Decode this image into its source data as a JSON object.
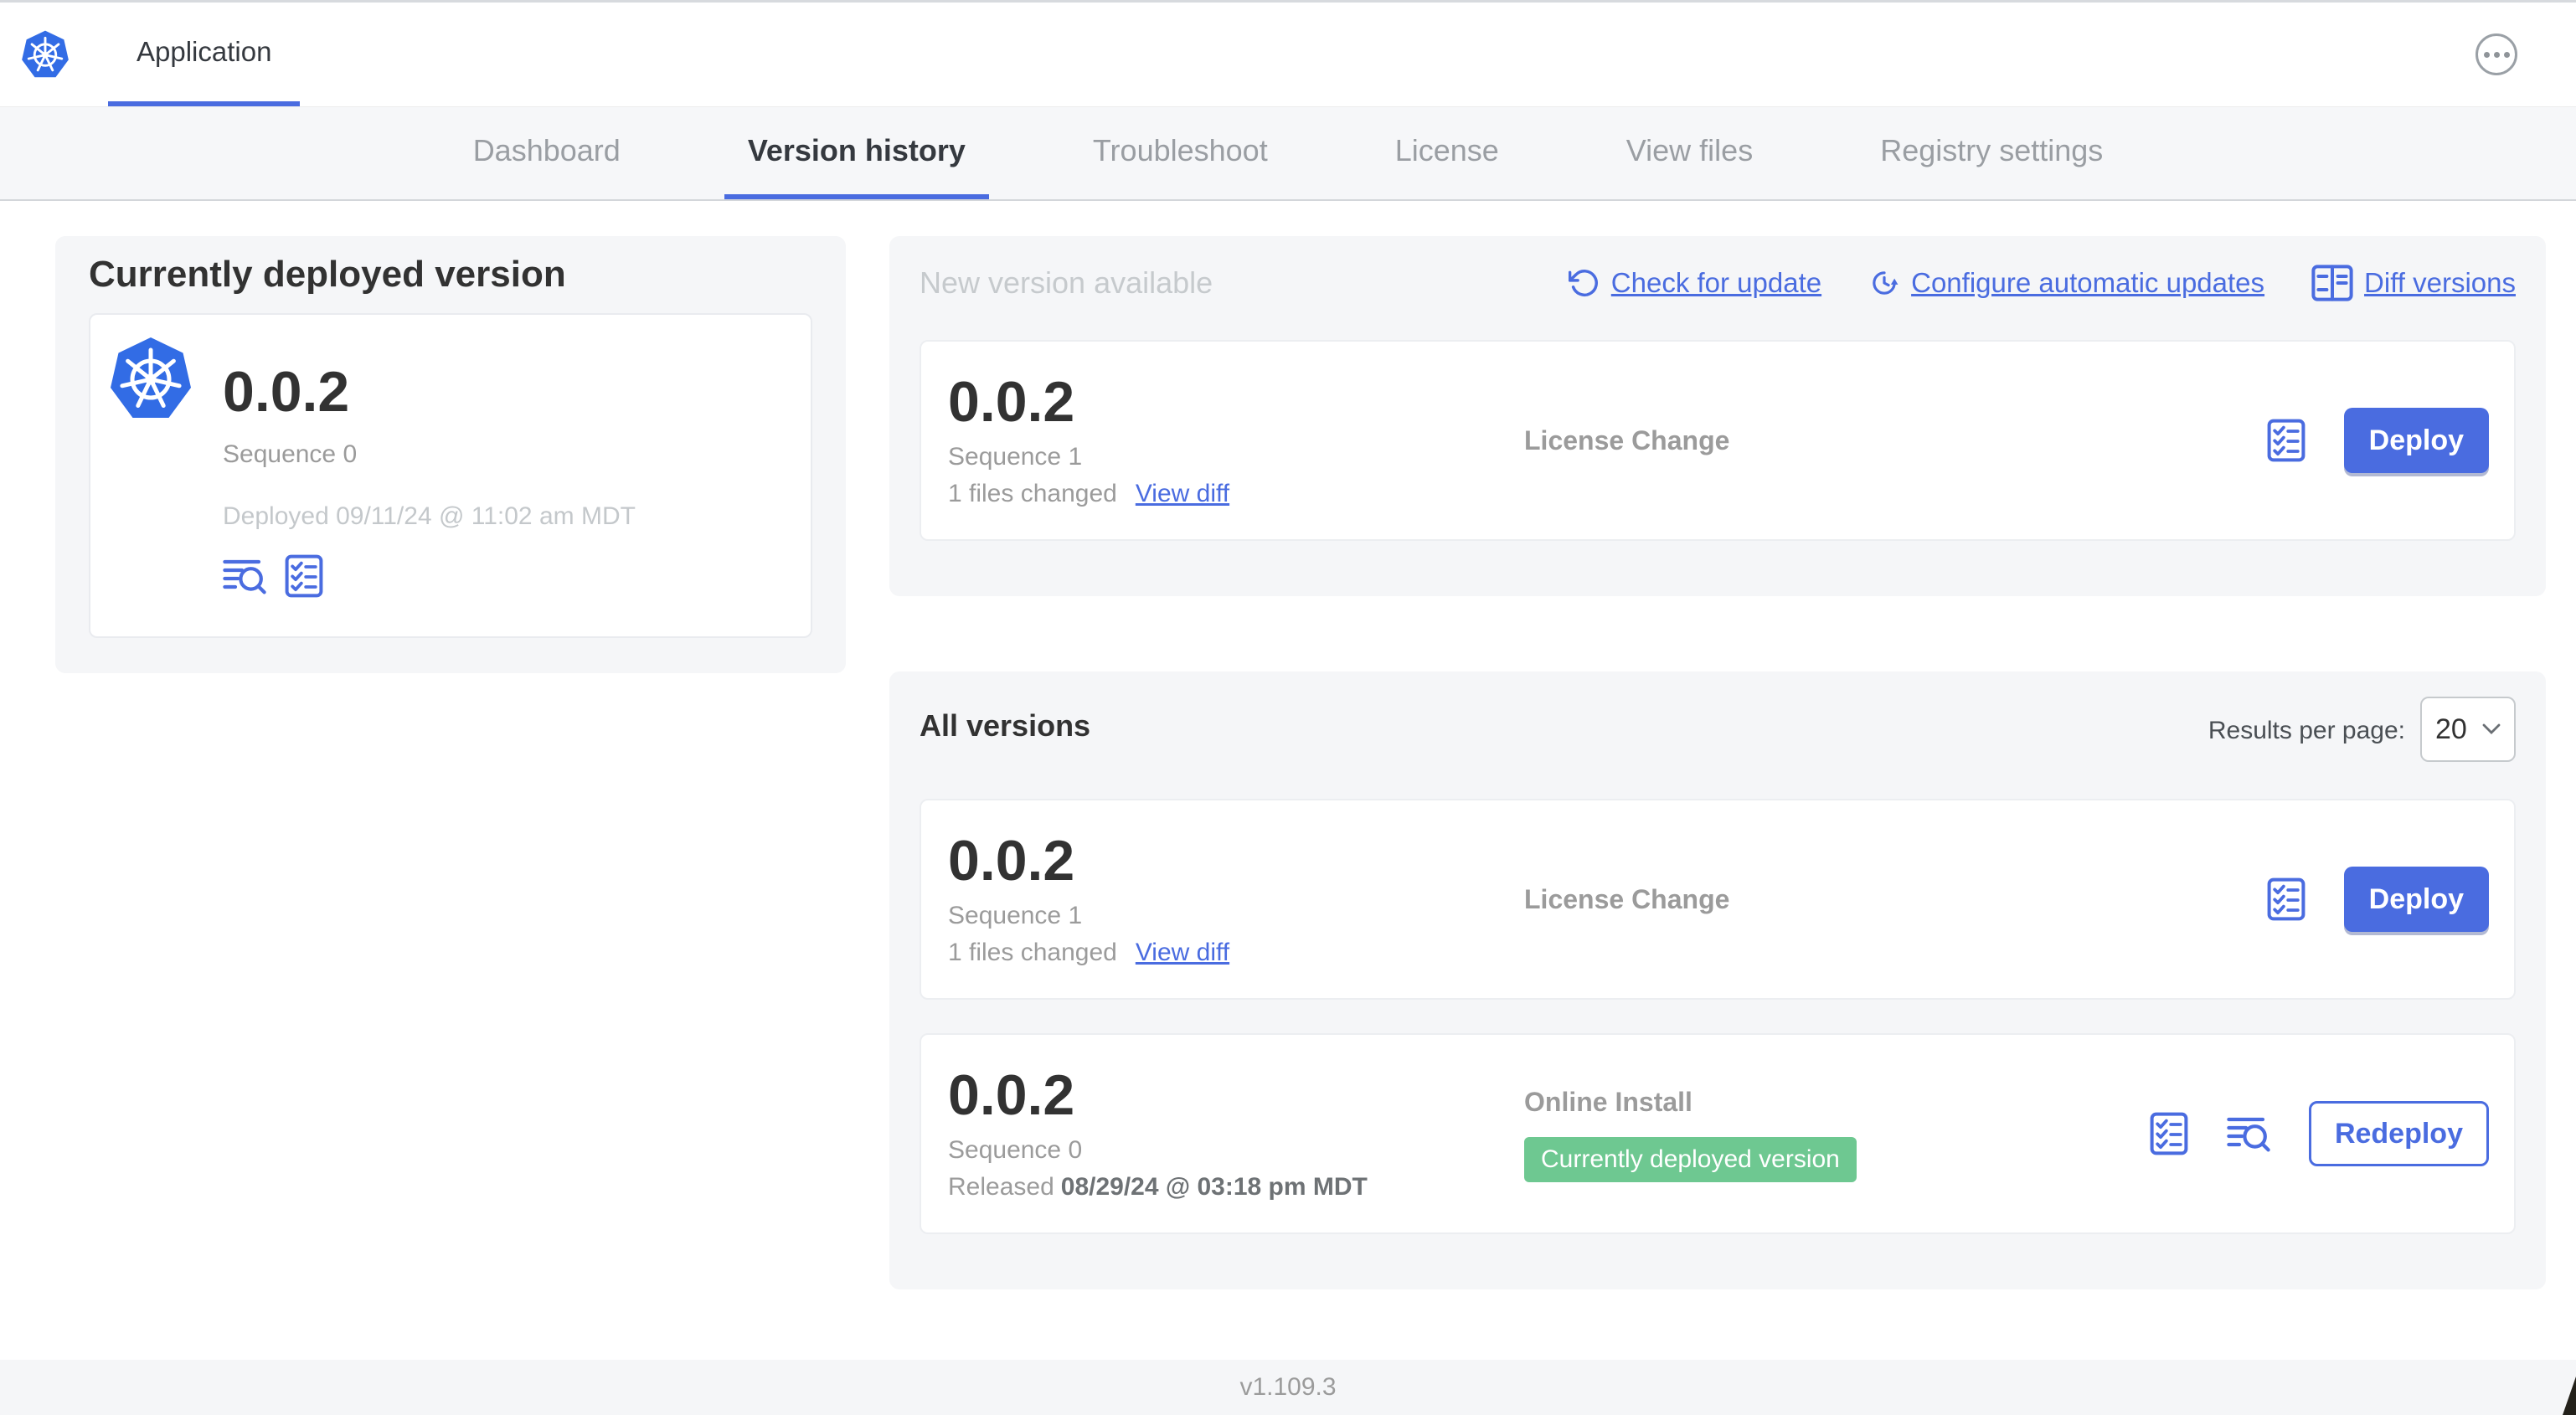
{
  "header": {
    "app_title": "Application"
  },
  "nav": {
    "tabs": [
      {
        "label": "Dashboard",
        "active": false
      },
      {
        "label": "Version history",
        "active": true
      },
      {
        "label": "Troubleshoot",
        "active": false
      },
      {
        "label": "License",
        "active": false
      },
      {
        "label": "View files",
        "active": false
      },
      {
        "label": "Registry settings",
        "active": false
      }
    ]
  },
  "current_version": {
    "title": "Currently deployed version",
    "version": "0.0.2",
    "sequence": "Sequence 0",
    "deployed": "Deployed 09/11/24 @ 11:02 am MDT"
  },
  "new_version": {
    "title": "New version available",
    "actions": {
      "check_for_update": "Check for update",
      "configure_automatic_updates": "Configure automatic updates",
      "diff_versions": "Diff versions"
    },
    "card": {
      "version": "0.0.2",
      "sequence": "Sequence 1",
      "files_changed": "1 files changed",
      "view_diff": "View diff",
      "source": "License Change",
      "action_label": "Deploy"
    }
  },
  "all_versions": {
    "title": "All versions",
    "results_per_page_label": "Results per page:",
    "results_per_page_value": "20",
    "rows": [
      {
        "version": "0.0.2",
        "sequence": "Sequence 1",
        "files_changed": "1 files changed",
        "view_diff": "View diff",
        "source": "License Change",
        "action_label": "Deploy"
      },
      {
        "version": "0.0.2",
        "sequence": "Sequence 0",
        "released_prefix": "Released",
        "released_date": "08/29/24 @ 03:18 pm MDT",
        "source": "Online Install",
        "badge": "Currently deployed version",
        "action_label": "Redeploy"
      }
    ]
  },
  "footer": {
    "app_version": "v1.109.3"
  },
  "colors": {
    "accent": "#4A6CE0",
    "badge_green": "#6EC891",
    "logo_blue": "#326CE5",
    "panel_gray": "#F5F6F8"
  },
  "icons": {
    "logo": "kubernetes-icon",
    "menu": "ellipsis-icon",
    "logs": "logs-icon",
    "checklist": "checklist-icon",
    "check_update": "refresh-icon",
    "auto_update": "update-clock-icon",
    "diff": "diff-icon",
    "select_chevron": "chevron-down-icon"
  }
}
